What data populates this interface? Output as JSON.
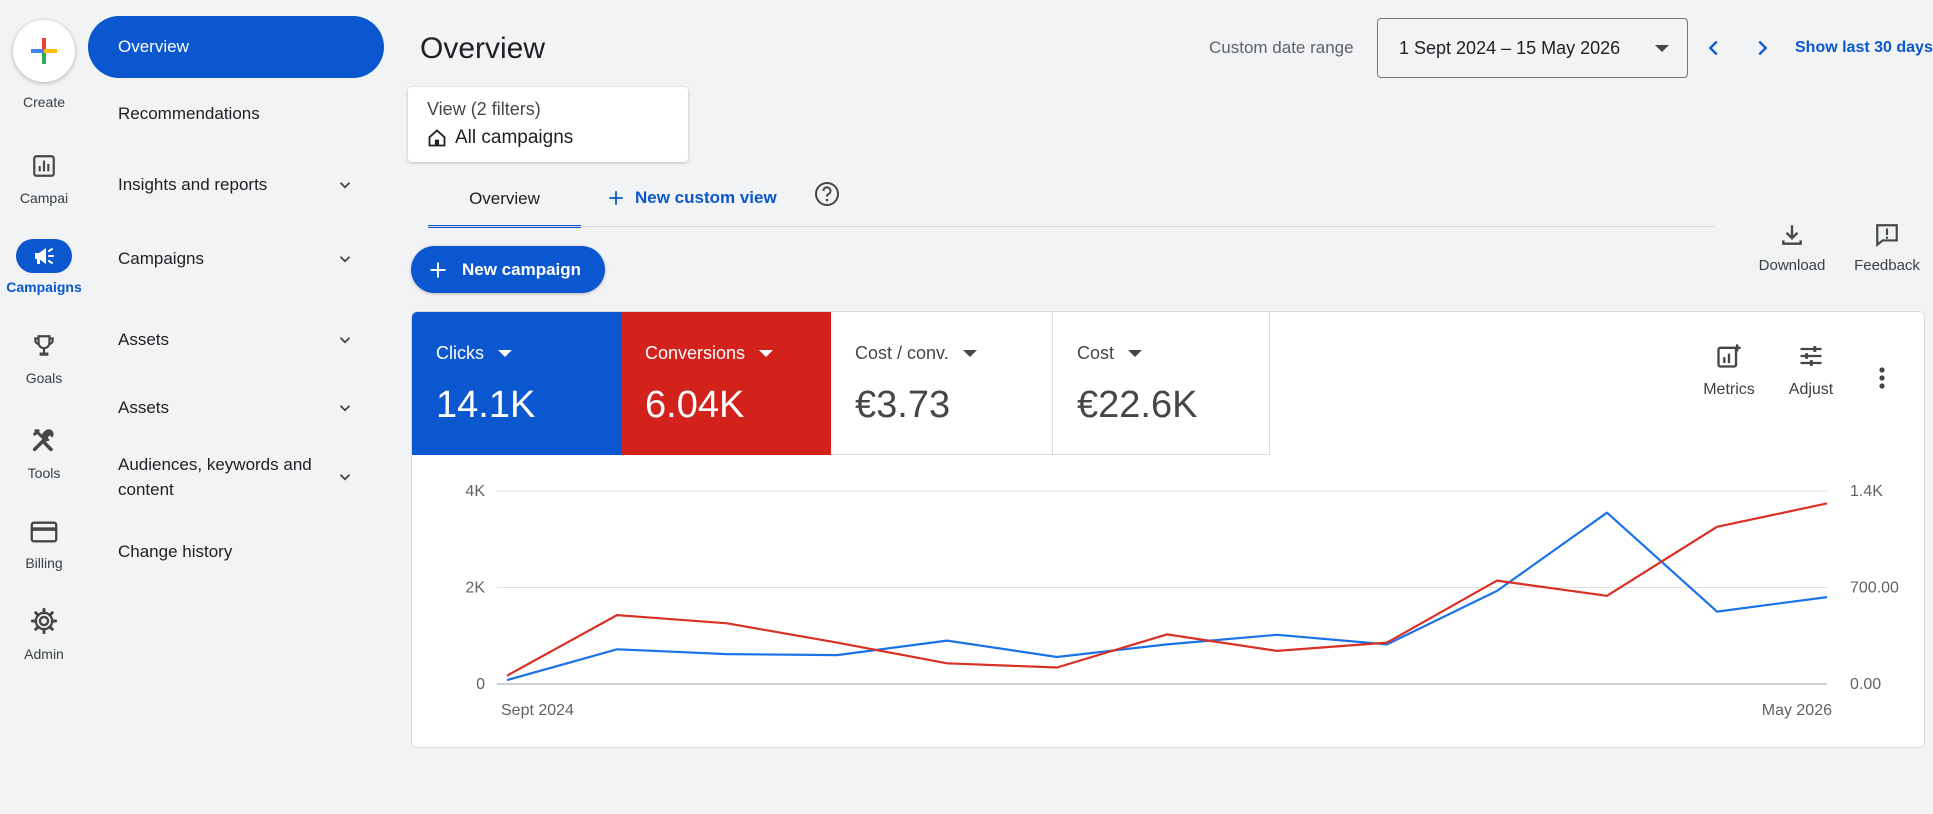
{
  "rail": {
    "create_label": "Create",
    "items": [
      {
        "label": "Campaigns",
        "icon": "bar-chart-icon",
        "display": "Campai"
      },
      {
        "label": "Campaigns",
        "icon": "megaphone-icon",
        "active": true
      },
      {
        "label": "Goals",
        "icon": "trophy-icon"
      },
      {
        "label": "Tools",
        "icon": "tools-icon"
      },
      {
        "label": "Billing",
        "icon": "credit-card-icon"
      },
      {
        "label": "Admin",
        "icon": "gear-icon"
      }
    ]
  },
  "nav": {
    "items": [
      {
        "label": "Overview",
        "active": true
      },
      {
        "label": "Recommendations"
      },
      {
        "label": "Insights and reports",
        "expandable": true
      },
      {
        "label": "Campaigns",
        "expandable": true
      },
      {
        "label": "Assets",
        "expandable": true
      },
      {
        "label": "Assets",
        "expandable": true
      },
      {
        "label": "Audiences, keywords and content",
        "expandable": true
      },
      {
        "label": "Change history"
      }
    ]
  },
  "header": {
    "title": "Overview",
    "date_range_label": "Custom date range",
    "date_range_value": "1 Sept 2024 – 15 May 2026",
    "show_last": "Show last 30 days"
  },
  "view": {
    "filters_label": "View (2 filters)",
    "scope": "All campaigns"
  },
  "tabs": {
    "overview": "Overview",
    "new_custom_view": "New custom view"
  },
  "toolbar": {
    "new_campaign": "New campaign",
    "download": "Download",
    "feedback": "Feedback"
  },
  "metrics": [
    {
      "name": "Clicks",
      "value": "14.1K",
      "color": "#0b57d0"
    },
    {
      "name": "Conversions",
      "value": "6.04K",
      "color": "#d3221c"
    },
    {
      "name": "Cost / conv.",
      "value": "€3.73"
    },
    {
      "name": "Cost",
      "value": "€22.6K"
    }
  ],
  "card_tools": {
    "metrics": "Metrics",
    "adjust": "Adjust"
  },
  "chart_data": {
    "type": "line",
    "x": [
      "Sept 2024",
      "",
      "",
      "",
      "",
      "",
      "",
      "",
      "",
      "",
      "",
      "",
      "",
      "",
      "",
      "May 2026"
    ],
    "x_tick_labels": [
      "Sept 2024",
      "May 2026"
    ],
    "y_left_ticks": [
      "0",
      "2K",
      "4K"
    ],
    "y_left_lim": [
      0,
      4000
    ],
    "y_right_ticks": [
      "0.00",
      "700.00",
      "1.4K"
    ],
    "y_right_lim": [
      0,
      1400
    ],
    "grid": true,
    "series": [
      {
        "axis": "left",
        "color": "#1a73e8",
        "values": [
          80,
          720,
          620,
          600,
          900,
          560,
          820,
          1020,
          820,
          1930,
          3550,
          1500,
          1800
        ]
      },
      {
        "axis": "right",
        "color": "#d93025",
        "values": [
          60,
          500,
          440,
          300,
          150,
          120,
          360,
          240,
          300,
          750,
          640,
          1140,
          1310
        ]
      }
    ]
  }
}
